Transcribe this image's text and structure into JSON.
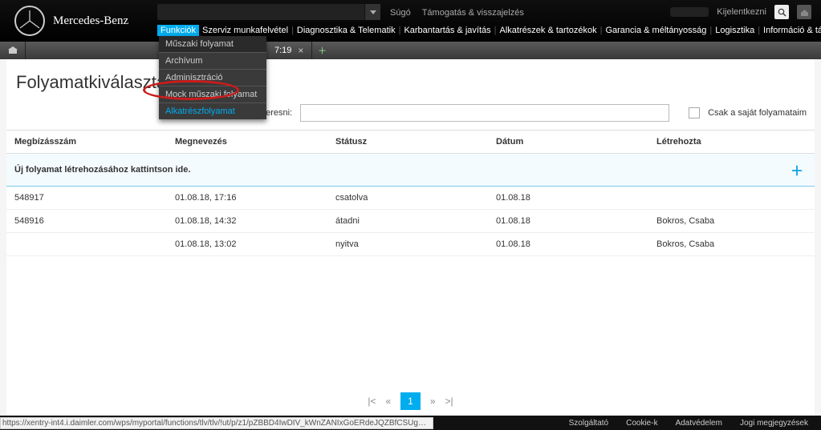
{
  "brand": "Mercedes-Benz",
  "top_aux": {
    "help": "Súgó",
    "support": "Támogatás & visszajelzés"
  },
  "top_right": {
    "logout": "Kijelentkezni"
  },
  "nav": {
    "items": [
      {
        "label": "Funkciók",
        "active": true
      },
      {
        "label": "Szerviz munkafelvétel"
      },
      {
        "label": "Diagnosztika & Telematik"
      },
      {
        "label": "Karbantartás & javítás"
      },
      {
        "label": "Alkatrészek & tartozékok"
      },
      {
        "label": "Garancia & méltányosság"
      },
      {
        "label": "Logisztika"
      },
      {
        "label": "Információ & támogatás"
      }
    ]
  },
  "dropdown": {
    "items": [
      "Műszaki folyamat",
      "Archívum",
      "Adminisztráció",
      "Mock műszaki folyamat",
      "Alkatrészfolyamat"
    ],
    "highlight_index": 4
  },
  "tab": {
    "label": "7:19"
  },
  "page": {
    "title": "Folyamatkiválasztás"
  },
  "search": {
    "label": "Keresni:",
    "only_mine": "Csak a saját folyamataim"
  },
  "table": {
    "headers": {
      "order": "Megbízásszám",
      "name": "Megnevezés",
      "status": "Státusz",
      "date": "Dátum",
      "created_by": "Létrehozta"
    },
    "newrow": "Új folyamat létrehozásához kattintson ide.",
    "rows": [
      {
        "order": "548917",
        "name": "01.08.18, 17:16",
        "status": "csatolva",
        "date": "01.08.18",
        "created_by": ""
      },
      {
        "order": "548916",
        "name": "01.08.18, 14:32",
        "status": "átadni",
        "date": "01.08.18",
        "created_by": "Bokros, Csaba"
      },
      {
        "order": "",
        "name": "01.08.18, 13:02",
        "status": "nyitva",
        "date": "01.08.18",
        "created_by": "Bokros, Csaba"
      }
    ]
  },
  "pager": {
    "first": "|<",
    "prev": "«",
    "current": "1",
    "next": "»",
    "last": ">|"
  },
  "footer": {
    "status_url": "https://xentry-int4.i.daimler.com/wps/myportal/functions/tlv/tlv/!ut/p/z1/pZBBD4IwDIV_kWnZANIxGoERdeJQZBfCSUglekB_v6DcIGm0x_Z9fe0DDUfQ...",
    "links": {
      "provider": "Szolgáltató",
      "cookie": "Cookie-k",
      "privacy": "Adatvédelem",
      "legal": "Jogi megjegyzések"
    }
  }
}
